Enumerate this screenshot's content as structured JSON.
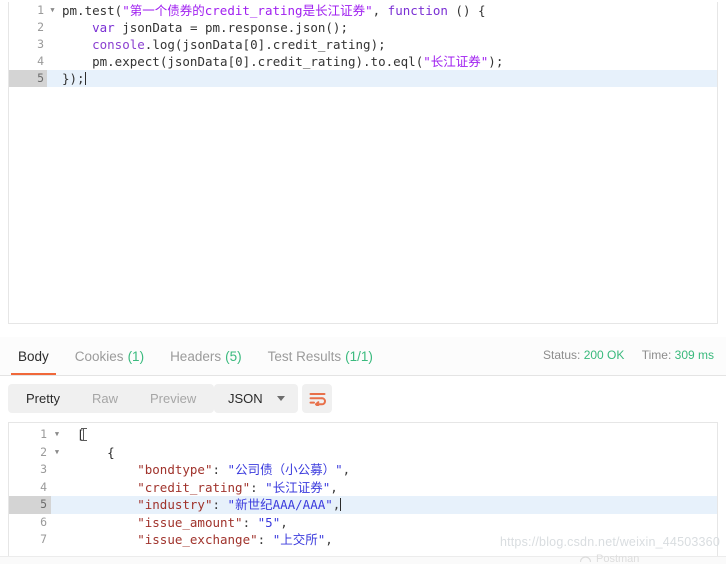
{
  "script_editor": {
    "lines": [
      {
        "number": "1",
        "foldable": true,
        "active": false,
        "tokens": [
          {
            "t": "plain",
            "v": "pm.test("
          },
          {
            "t": "str",
            "v": "\"第一个债券的credit_rating是长江证券\""
          },
          {
            "t": "plain",
            "v": ", "
          },
          {
            "t": "kw",
            "v": "function"
          },
          {
            "t": "plain",
            "v": " () {"
          }
        ]
      },
      {
        "number": "2",
        "foldable": false,
        "active": false,
        "tokens": [
          {
            "t": "plain",
            "v": "    "
          },
          {
            "t": "kw",
            "v": "var"
          },
          {
            "t": "plain",
            "v": " jsonData = pm.response.json();"
          }
        ]
      },
      {
        "number": "3",
        "foldable": false,
        "active": false,
        "tokens": [
          {
            "t": "plain",
            "v": "    "
          },
          {
            "t": "fn",
            "v": "console"
          },
          {
            "t": "plain",
            "v": ".log(jsonData[0].credit_rating);"
          }
        ]
      },
      {
        "number": "4",
        "foldable": false,
        "active": false,
        "tokens": [
          {
            "t": "plain",
            "v": "    pm.expect(jsonData[0].credit_rating).to.eql("
          },
          {
            "t": "str",
            "v": "\"长江证券\""
          },
          {
            "t": "plain",
            "v": ");"
          }
        ]
      },
      {
        "number": "5",
        "foldable": false,
        "active": true,
        "caret": true,
        "tokens": [
          {
            "t": "plain",
            "v": "});"
          }
        ]
      }
    ]
  },
  "response": {
    "tabs": [
      {
        "label": "Body",
        "count": "",
        "active": true
      },
      {
        "label": "Cookies",
        "count": "(1)",
        "active": false
      },
      {
        "label": "Headers",
        "count": "(5)",
        "active": false
      },
      {
        "label": "Test Results",
        "count": "(1/1)",
        "active": false
      }
    ],
    "meta": {
      "status_label": "Status:",
      "status_value": "200 OK",
      "time_label": "Time:",
      "time_value": "309 ms"
    },
    "view_modes": [
      {
        "label": "Pretty",
        "active": true
      },
      {
        "label": "Raw",
        "active": false
      },
      {
        "label": "Preview",
        "active": false
      }
    ],
    "format_select": {
      "value": "JSON",
      "icon": "chevron-down-icon"
    },
    "wrap_button_icon": "word-wrap-icon",
    "body_lines": [
      {
        "number": "1",
        "foldable": true,
        "active": false,
        "cursor": true,
        "tokens": [
          {
            "t": "br",
            "v": "["
          }
        ]
      },
      {
        "number": "2",
        "foldable": true,
        "active": false,
        "tokens": [
          {
            "t": "br",
            "v": "    {"
          }
        ]
      },
      {
        "number": "3",
        "foldable": false,
        "active": false,
        "tokens": [
          {
            "t": "pun",
            "v": "        "
          },
          {
            "t": "key",
            "v": "\"bondtype\""
          },
          {
            "t": "pun",
            "v": ": "
          },
          {
            "t": "str",
            "v": "\"公司债（小公募）\""
          },
          {
            "t": "pun",
            "v": ","
          }
        ]
      },
      {
        "number": "4",
        "foldable": false,
        "active": false,
        "tokens": [
          {
            "t": "pun",
            "v": "        "
          },
          {
            "t": "key",
            "v": "\"credit_rating\""
          },
          {
            "t": "pun",
            "v": ": "
          },
          {
            "t": "str",
            "v": "\"长江证券\""
          },
          {
            "t": "pun",
            "v": ","
          }
        ]
      },
      {
        "number": "5",
        "foldable": false,
        "active": true,
        "caret": true,
        "tokens": [
          {
            "t": "pun",
            "v": "        "
          },
          {
            "t": "key",
            "v": "\"industry\""
          },
          {
            "t": "pun",
            "v": ": "
          },
          {
            "t": "str",
            "v": "\"新世纪AAA/AAA\""
          },
          {
            "t": "pun",
            "v": ","
          }
        ]
      },
      {
        "number": "6",
        "foldable": false,
        "active": false,
        "tokens": [
          {
            "t": "pun",
            "v": "        "
          },
          {
            "t": "key",
            "v": "\"issue_amount\""
          },
          {
            "t": "pun",
            "v": ": "
          },
          {
            "t": "str",
            "v": "\"5\""
          },
          {
            "t": "pun",
            "v": ","
          }
        ]
      },
      {
        "number": "7",
        "foldable": false,
        "active": false,
        "tokens": [
          {
            "t": "pun",
            "v": "        "
          },
          {
            "t": "key",
            "v": "\"issue_exchange\""
          },
          {
            "t": "pun",
            "v": ": "
          },
          {
            "t": "str",
            "v": "\"上交所\""
          },
          {
            "t": "pun",
            "v": ","
          }
        ]
      }
    ]
  },
  "watermark": {
    "url": "https://blog.csdn.net/weixin_44503360",
    "app": "Postman"
  },
  "colors": {
    "accent_orange": "#f0683a",
    "status_green": "#39b97c",
    "string_purple": "#a020f0",
    "json_key": "#a0332c",
    "json_string": "#3b3bdd",
    "active_line": "#e7f1fb"
  }
}
